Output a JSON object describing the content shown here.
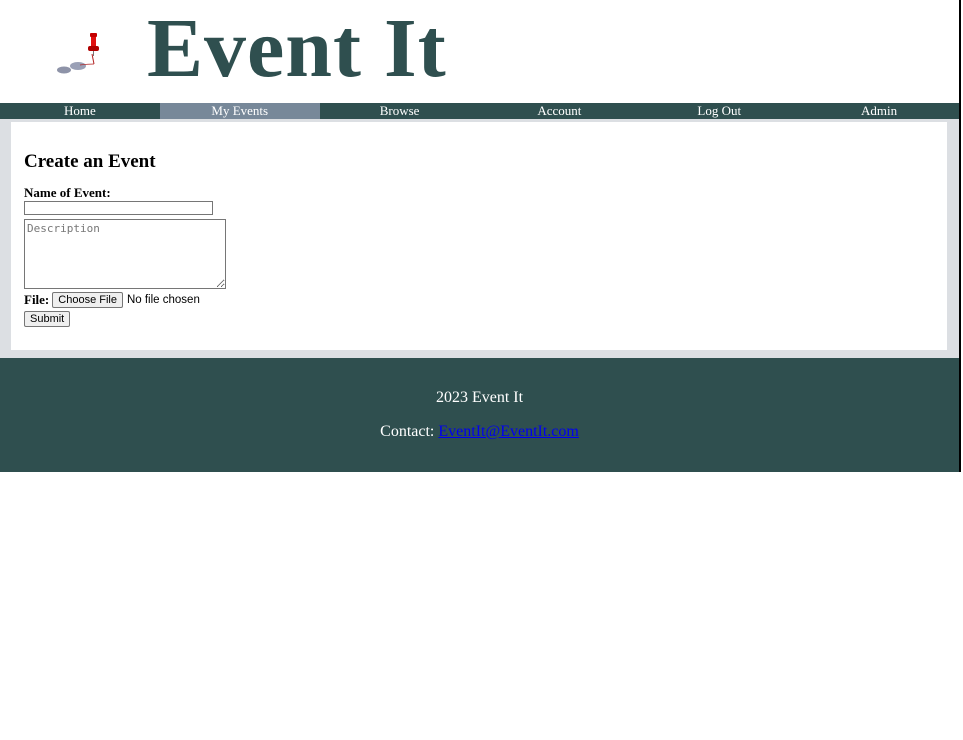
{
  "header": {
    "site_title": "Event It",
    "logo_icon": "pushpin-footprints-icon"
  },
  "nav": {
    "items": [
      {
        "label": "Home"
      },
      {
        "label": "My Events",
        "active": true
      },
      {
        "label": "Browse"
      },
      {
        "label": "Account"
      },
      {
        "label": "Log Out"
      },
      {
        "label": "Admin"
      }
    ]
  },
  "form": {
    "heading": "Create an Event",
    "name_label": "Name of Event:",
    "name_value": "",
    "description_placeholder": "Description",
    "file_label": "File:",
    "choose_file_label": "Choose File",
    "file_status": "No file chosen",
    "submit_label": "Submit"
  },
  "footer": {
    "copyright": "2023 Event It",
    "contact_label": "Contact:",
    "contact_email": "EventIt@EventIt.com"
  },
  "colors": {
    "brand": "#2f4f4f",
    "nav_active": "#778899",
    "content_border": "#dcdfe3",
    "link": "#0000ee"
  }
}
